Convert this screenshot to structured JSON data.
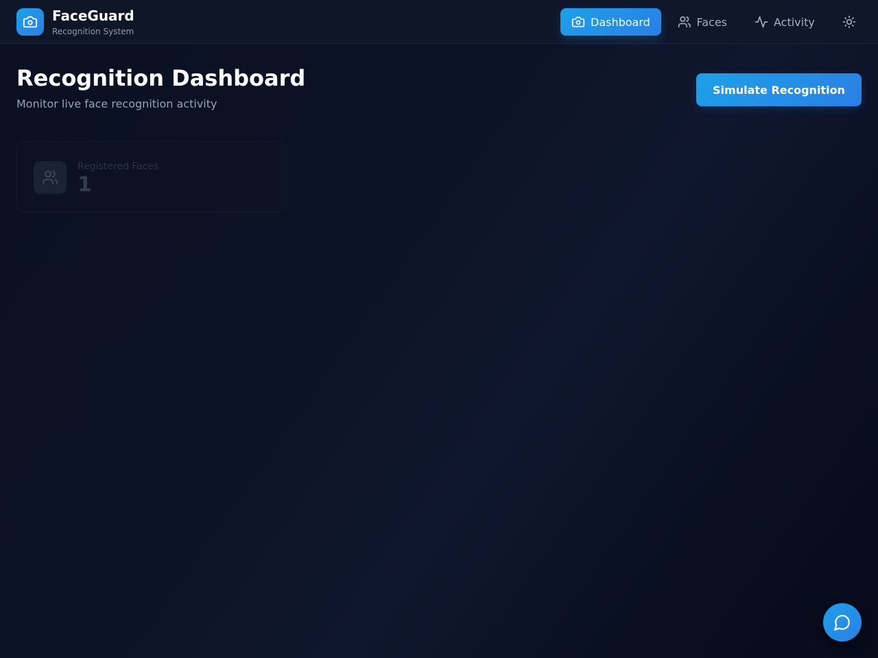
{
  "app": {
    "name": "FaceGuard",
    "subtitle": "Recognition System",
    "logo_icon": "camera-icon",
    "accent_color": "#1da1e8"
  },
  "nav": {
    "items": [
      {
        "label": "Dashboard",
        "icon": "camera-icon",
        "active": true
      },
      {
        "label": "Faces",
        "icon": "users-icon",
        "active": false
      },
      {
        "label": "Activity",
        "icon": "activity-icon",
        "active": false
      }
    ],
    "theme_toggle_icon": "sun-icon"
  },
  "header": {
    "title": "Recognition Dashboard",
    "subtitle": "Monitor live face recognition activity",
    "action_label": "Simulate Recognition"
  },
  "stats": [
    {
      "label": "Registered Faces",
      "value": "1",
      "icon": "users-icon"
    }
  ],
  "chat": {
    "icon": "chat-bubble-icon"
  }
}
